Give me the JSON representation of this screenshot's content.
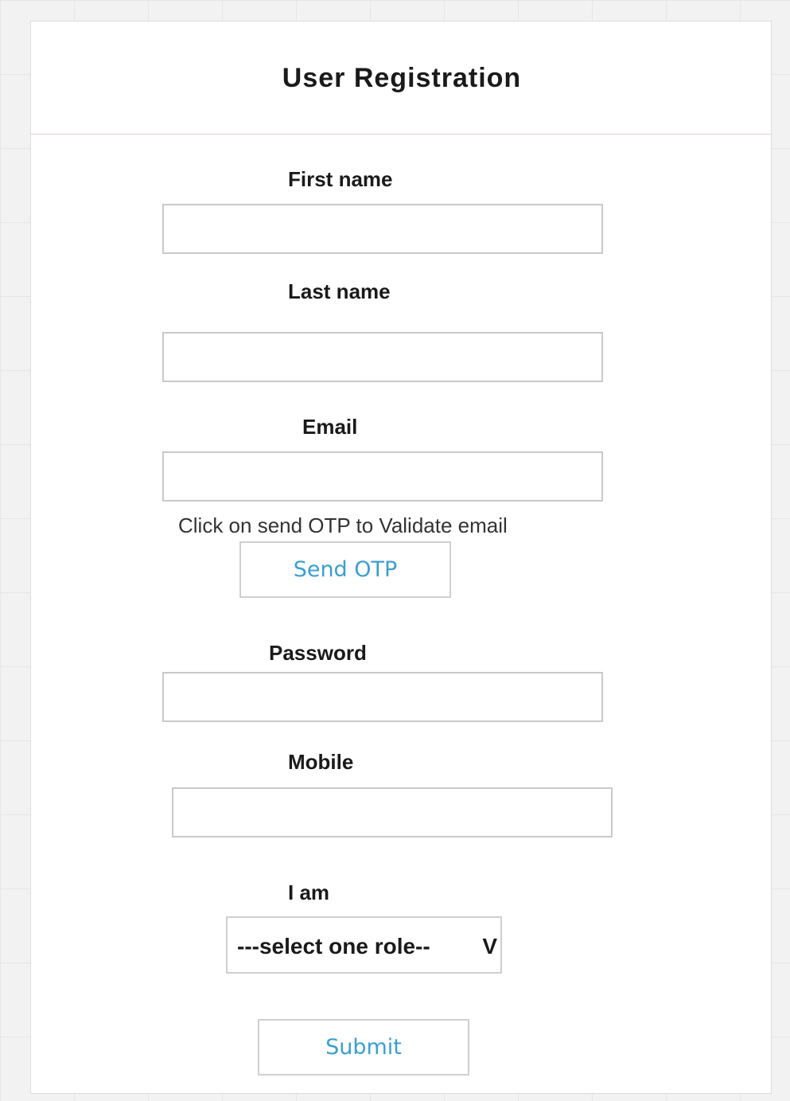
{
  "form": {
    "title": "User Registration",
    "fields": {
      "first_name": {
        "label": "First name",
        "value": ""
      },
      "last_name": {
        "label": "Last name",
        "value": ""
      },
      "email": {
        "label": "Email",
        "value": "",
        "hint": "Click on send OTP to Validate email"
      },
      "password": {
        "label": "Password",
        "value": ""
      },
      "mobile": {
        "label": "Mobile",
        "value": ""
      },
      "role": {
        "label": "I am",
        "selected": "---select one role--",
        "arrow": "V"
      }
    },
    "send_otp_label": "Send OTP",
    "submit_label": "Submit"
  },
  "colors": {
    "button_text": "#3b9fd1",
    "header_divider": "#e7cfcf",
    "border": "#c9c9c9"
  }
}
